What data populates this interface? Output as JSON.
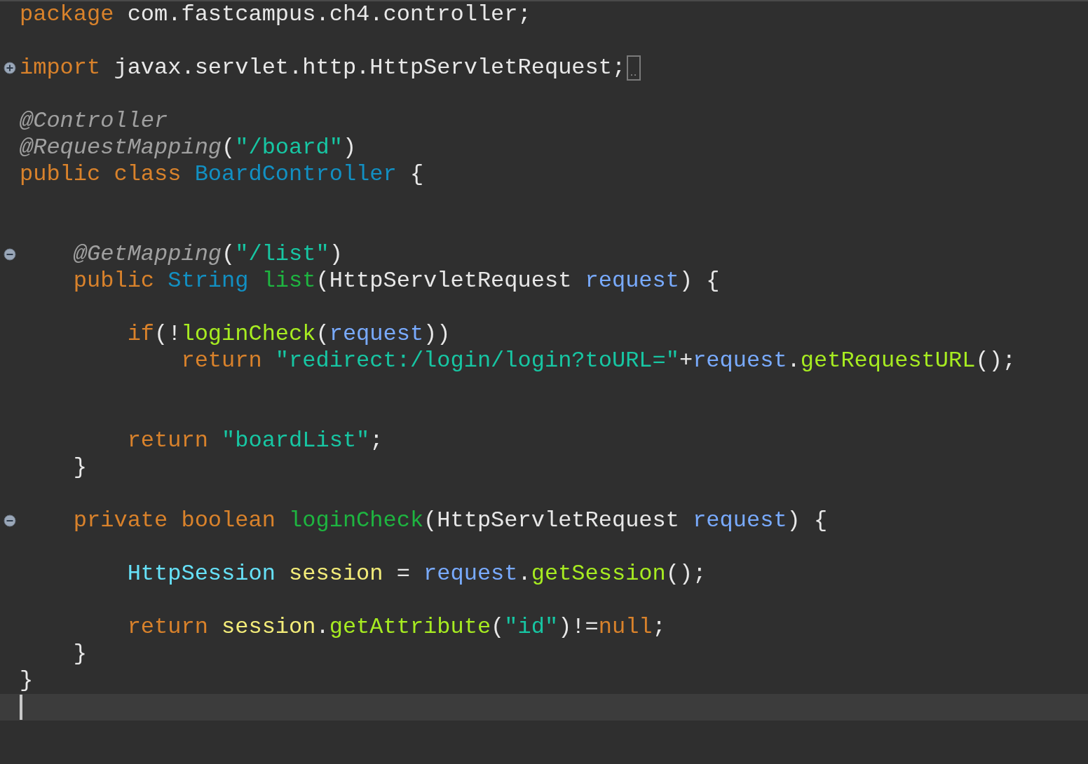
{
  "editor": {
    "lines": [
      {
        "kind": "code",
        "tokens": [
          {
            "text": "package",
            "kind": "keyword"
          },
          {
            "text": " com.fastcampus.ch4.controller;",
            "kind": "plain"
          }
        ]
      },
      {
        "kind": "code"
      },
      {
        "kind": "code",
        "folded": true,
        "tokens": [
          {
            "text": "import",
            "kind": "keyword"
          },
          {
            "text": " javax.servlet.http.HttpServletRequest;",
            "kind": "plain"
          }
        ]
      },
      {
        "kind": "code"
      },
      {
        "kind": "code",
        "tokens": [
          {
            "text": "@Controller",
            "kind": "annotation"
          }
        ]
      },
      {
        "kind": "code",
        "tokens": [
          {
            "text": "@RequestMapping",
            "kind": "annotation"
          },
          {
            "text": "(",
            "kind": "plain"
          },
          {
            "text": "\"/board\"",
            "kind": "string"
          },
          {
            "text": ")",
            "kind": "plain"
          }
        ]
      },
      {
        "kind": "code",
        "tokens": [
          {
            "text": "public class",
            "kind": "keyword"
          },
          {
            "text": " BoardController",
            "kind": "class"
          },
          {
            "text": " {",
            "kind": "plain"
          }
        ]
      },
      {
        "kind": "code"
      },
      {
        "kind": "code"
      },
      {
        "kind": "code",
        "folded": false,
        "tokens": [
          {
            "text": "    @GetMapping",
            "kind": "annotation"
          },
          {
            "text": "(",
            "kind": "plain"
          },
          {
            "text": "\"/list\"",
            "kind": "string"
          },
          {
            "text": ")",
            "kind": "plain"
          }
        ]
      },
      {
        "kind": "code",
        "tokens": [
          {
            "text": "    public",
            "kind": "keyword"
          },
          {
            "text": " String",
            "kind": "class"
          },
          {
            "text": " list",
            "kind": "method_decl"
          },
          {
            "text": "(HttpServletRequest",
            "kind": "plain"
          },
          {
            "text": " request",
            "kind": "param"
          },
          {
            "text": ") {",
            "kind": "plain"
          }
        ]
      },
      {
        "kind": "code"
      },
      {
        "kind": "code",
        "tokens": [
          {
            "text": "        if",
            "kind": "keyword"
          },
          {
            "text": "(!",
            "kind": "plain"
          },
          {
            "text": "loginCheck",
            "kind": "method"
          },
          {
            "text": "(",
            "kind": "plain"
          },
          {
            "text": "request",
            "kind": "param"
          },
          {
            "text": "))",
            "kind": "plain"
          }
        ]
      },
      {
        "kind": "code",
        "tokens": [
          {
            "text": "            return",
            "kind": "keyword"
          },
          {
            "text": " \"redirect:/login/login?toURL=\"",
            "kind": "string"
          },
          {
            "text": "+",
            "kind": "plain"
          },
          {
            "text": "request",
            "kind": "param"
          },
          {
            "text": ".",
            "kind": "plain"
          },
          {
            "text": "getRequestURL",
            "kind": "method"
          },
          {
            "text": "();",
            "kind": "plain"
          }
        ]
      },
      {
        "kind": "code"
      },
      {
        "kind": "code"
      },
      {
        "kind": "code",
        "tokens": [
          {
            "text": "        return",
            "kind": "keyword"
          },
          {
            "text": " \"boardList\"",
            "kind": "string"
          },
          {
            "text": ";",
            "kind": "plain"
          }
        ]
      },
      {
        "kind": "code",
        "tokens": [
          {
            "text": "    }",
            "kind": "plain"
          }
        ]
      },
      {
        "kind": "code"
      },
      {
        "kind": "code",
        "folded": false,
        "tokens": [
          {
            "text": "    private boolean",
            "kind": "keyword"
          },
          {
            "text": " loginCheck",
            "kind": "method_decl"
          },
          {
            "text": "(HttpServletRequest",
            "kind": "plain"
          },
          {
            "text": " request",
            "kind": "param"
          },
          {
            "text": ") {",
            "kind": "plain"
          }
        ]
      },
      {
        "kind": "code"
      },
      {
        "kind": "code",
        "tokens": [
          {
            "text": "        HttpSession",
            "kind": "type_ref"
          },
          {
            "text": " session",
            "kind": "local"
          },
          {
            "text": " = ",
            "kind": "plain"
          },
          {
            "text": "request",
            "kind": "param"
          },
          {
            "text": ".",
            "kind": "plain"
          },
          {
            "text": "getSession",
            "kind": "method"
          },
          {
            "text": "();",
            "kind": "plain"
          }
        ]
      },
      {
        "kind": "code"
      },
      {
        "kind": "code",
        "tokens": [
          {
            "text": "        return",
            "kind": "keyword"
          },
          {
            "text": " session",
            "kind": "local"
          },
          {
            "text": ".",
            "kind": "plain"
          },
          {
            "text": "getAttribute",
            "kind": "method"
          },
          {
            "text": "(",
            "kind": "plain"
          },
          {
            "text": "\"id\"",
            "kind": "string"
          },
          {
            "text": ")!=",
            "kind": "plain"
          },
          {
            "text": "null",
            "kind": "keyword"
          },
          {
            "text": ";",
            "kind": "plain"
          }
        ]
      },
      {
        "kind": "code",
        "tokens": [
          {
            "text": "    }",
            "kind": "plain"
          }
        ]
      },
      {
        "kind": "code",
        "tokens": [
          {
            "text": "}",
            "kind": "plain"
          }
        ]
      },
      {
        "kind": "cursor"
      }
    ]
  }
}
